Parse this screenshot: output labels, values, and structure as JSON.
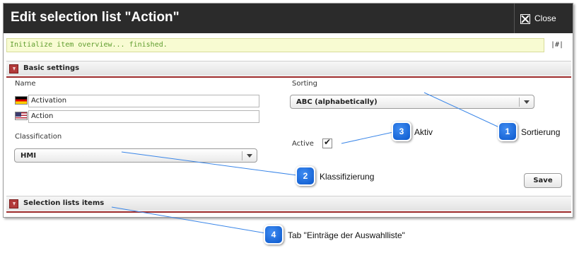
{
  "dialog": {
    "title": "Edit selection list \"Action\"",
    "close_label": "Close"
  },
  "status": {
    "message": "Initialize item overview... finished.",
    "hash_link": "|#|"
  },
  "basic_settings": {
    "title": "Basic settings",
    "name_label": "Name",
    "name_de": "Activation",
    "name_en": "Action",
    "classification_label": "Classification",
    "classification_value": "HMI",
    "sorting_label": "Sorting",
    "sorting_value": "ABC (alphabetically)",
    "active_label": "Active",
    "active_checked": true,
    "save_label": "Save"
  },
  "selection_items": {
    "title": "Selection lists items"
  },
  "callouts": [
    {
      "number": "1",
      "text": "Sortierung"
    },
    {
      "number": "2",
      "text": "Klassifizierung"
    },
    {
      "number": "3",
      "text": "Aktiv"
    },
    {
      "number": "4",
      "text": "Tab \"Einträge der Auswahlliste\""
    }
  ],
  "colors": {
    "titlebar": "#2b2b2b",
    "status_text": "#5f9d2e",
    "status_bg": "#f8fbd2",
    "section_accent": "#9c2a2a",
    "callout_blue": "#1a6fe0"
  }
}
